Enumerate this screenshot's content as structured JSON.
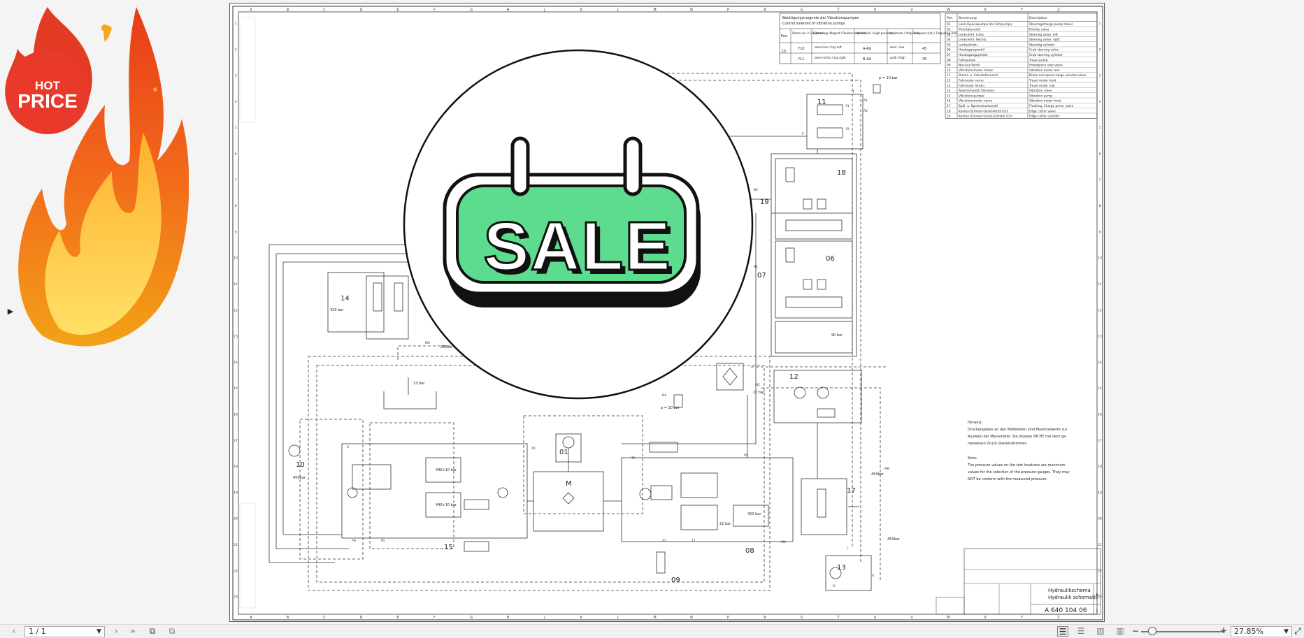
{
  "overlay": {
    "hot_price": {
      "line1": "HOT",
      "line2": "PRICE"
    },
    "sale_sign": {
      "label": "SALE",
      "color": "#5ddc8f"
    }
  },
  "drawing": {
    "grid_letters": [
      "A",
      "B",
      "C",
      "D",
      "E",
      "F",
      "G",
      "H",
      "J",
      "K",
      "L",
      "M",
      "N",
      "P",
      "R",
      "S",
      "T",
      "U",
      "V",
      "W",
      "X",
      "Y",
      "Z"
    ],
    "grid_numbers": [
      "1",
      "2",
      "3",
      "4",
      "5",
      "6",
      "7",
      "8",
      "9",
      "10",
      "11",
      "12",
      "13",
      "14",
      "15",
      "16",
      "17",
      "18",
      "19",
      "20",
      "21",
      "22",
      "23"
    ],
    "vibration_table": {
      "title_de": "Betätigungsmagnete der Vibrationspumpen",
      "title_en": "Control solenoid of vibration pumps",
      "headers": [
        "Pos.",
        "Strom ein / Current on",
        "Einbaulage Magnet / Position solenoid",
        "Hochdruck / High pressure",
        "Amplitude / Amplitude",
        "Frequenz [Hz] / Frequency [Hz]"
      ],
      "rows": [
        [
          "15",
          "Y10",
          "oben links / top left",
          "A-AG",
          "klein / low",
          "45"
        ],
        [
          "",
          "Y11",
          "oben rechts / top right",
          "B-AG",
          "groß / high",
          "35"
        ]
      ]
    },
    "parts_table": {
      "headers": [
        "Pos.",
        "Benennung",
        "Description"
      ],
      "rows": [
        [
          "01",
          "Lenk-/Speisepumpe der Fahrpumpe",
          "Steering/charge pump travel"
        ],
        [
          "02",
          "Prioritätsventil",
          "Priority valve"
        ],
        [
          "03",
          "Lenkventil: Links",
          "Steering valve: left"
        ],
        [
          "04",
          "Lenkventil: Rechts",
          "Steering valve: right"
        ],
        [
          "05",
          "Lenkzylinder",
          "Steering cylinder"
        ],
        [
          "06",
          "Hundegangventil",
          "Crab steering valve"
        ],
        [
          "07",
          "Hundegangzylinder",
          "Crab steering cylinder"
        ],
        [
          "08",
          "Fahrpumpe",
          "Travel pump"
        ],
        [
          "09",
          "Not-Aus-Ventil",
          "Emergency stop valve"
        ],
        [
          "10",
          "Vibrationsmotor hinten",
          "Vibration motor rear"
        ],
        [
          "11",
          "Brems- u. Fahrstufenventil",
          "Brake and speed range selector valve"
        ],
        [
          "12",
          "Fahrmotor vorne",
          "Travel motor front"
        ],
        [
          "13",
          "Fahrmotor hinten",
          "Travel motor rear"
        ],
        [
          "14",
          "Abschaltventil Vibration",
          "Vibration valve"
        ],
        [
          "15",
          "Vibrationspumpe",
          "Vibration pump"
        ],
        [
          "16",
          "Vibrationsmotor vorne",
          "Vibration motor front"
        ],
        [
          "17",
          "Spül- u. Speisedruckventil",
          "Flushing, Charge press. valve"
        ],
        [
          "18",
          "Kanten-Schneid-Gerät-Ventil (Ch)",
          "Edge cutter valve"
        ],
        [
          "19",
          "Kanten-Schneid-Gerät-Zylinder (Ch)",
          "Edge cutter cylinder"
        ]
      ]
    },
    "component_labels": [
      "01",
      "06",
      "07",
      "08",
      "09",
      "10",
      "11",
      "12",
      "13",
      "14",
      "15",
      "17",
      "18",
      "19",
      "M"
    ],
    "pressure_labels": [
      "p = 10 bar",
      "420 bar",
      "13 bar",
      "440+10 bar",
      "440+10 bar",
      "250bar",
      "p = 10 bar",
      "22 bar",
      "90 bar",
      "420 bar",
      "22 bar",
      "450bar",
      "450bar",
      "450bar"
    ],
    "port_labels": [
      "T",
      "A1",
      "A2",
      "B1",
      "B2",
      "P",
      "Y1",
      "Y2",
      "MA",
      "MB",
      "PS",
      "X1",
      "X2",
      "S",
      "L",
      "R",
      "X",
      "T1",
      "T2",
      "M3",
      "M2",
      "B4",
      "Pe",
      "Pa"
    ],
    "notes": {
      "de_title": "Hinweis:",
      "de_lines": [
        "Druckangaben an den Meßstellen sind Maximalwerte zur",
        "Auswahl der Manometer. Sie müssen NICHT mit dem ge-",
        "messenen Druck übereinstimmen."
      ],
      "en_title": "Note:",
      "en_lines": [
        "The pressure values on the test locations are maximum",
        "values for the selection of the pressure gauges. They may",
        "NOT be conform with the measured pressure."
      ]
    },
    "title_block": {
      "title_de": "Hydraulikschema",
      "title_en": "Hydraulik schematic",
      "drawing_number": "A 640 104 06",
      "sheet": "1",
      "index": "A"
    }
  },
  "statusbar": {
    "page_indicator": "1 / 1",
    "zoom": "27.85%",
    "zoom_level": 0.08
  }
}
